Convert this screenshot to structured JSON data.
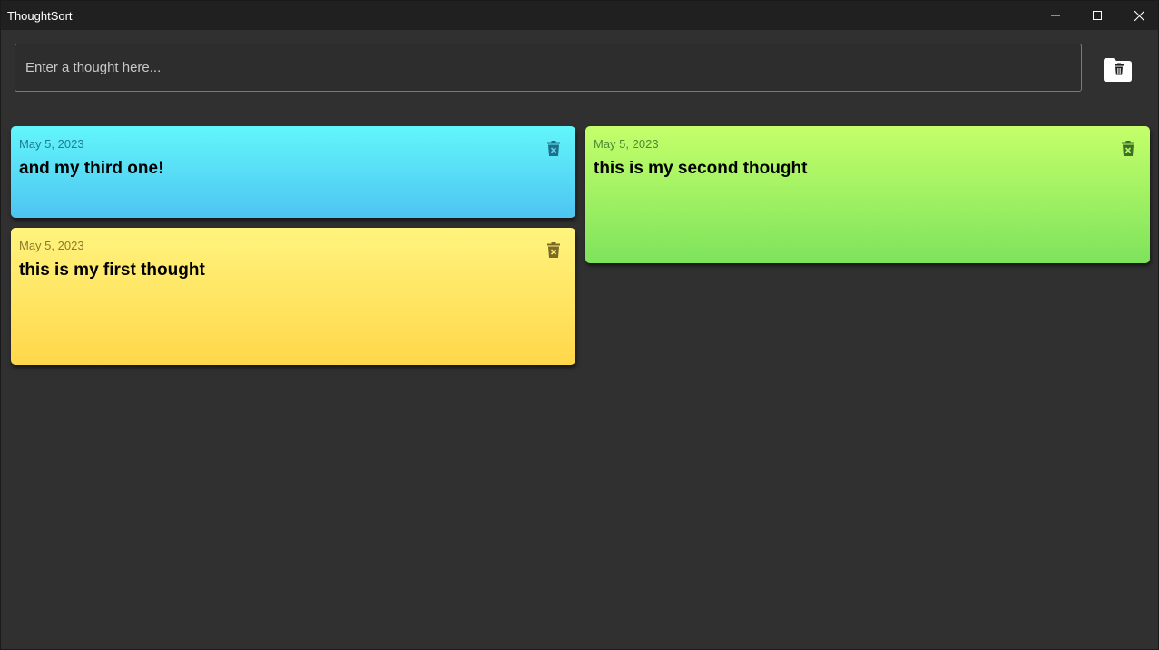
{
  "window": {
    "title": "ThoughtSort"
  },
  "input": {
    "placeholder": "Enter a thought here...",
    "value": ""
  },
  "toolbar": {
    "clear_all_icon": "folder-delete-icon"
  },
  "colors": {
    "background": "#303030",
    "titlebar": "#202020",
    "card_blue": "#56d8f6",
    "card_yellow": "#ffe564",
    "card_green": "#a4f062"
  },
  "cards": [
    {
      "date": "May 5, 2023",
      "text": "and my third one!",
      "color": "blue"
    },
    {
      "date": "May 5, 2023",
      "text": "this is my first thought",
      "color": "yellow"
    },
    {
      "date": "May 5, 2023",
      "text": "this is my second thought",
      "color": "green"
    }
  ]
}
